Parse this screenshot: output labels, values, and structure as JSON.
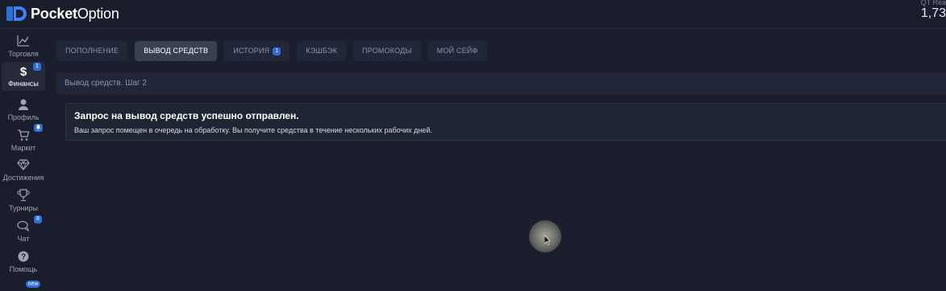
{
  "app": {
    "logo_bold": "Pocket",
    "logo_light": "Option",
    "balance_label": "QT Rea",
    "balance_value": "1,73"
  },
  "sidebar": {
    "items": [
      {
        "label": "Торговля",
        "icon": "chart-icon"
      },
      {
        "label": "Финансы",
        "icon": "dollar-icon",
        "badge": "1",
        "active": true
      },
      {
        "label": "Профиль",
        "icon": "user-icon"
      },
      {
        "label": "Маркет",
        "icon": "cart-icon",
        "badge_icon": "bell-icon"
      },
      {
        "label": "Достижения",
        "icon": "diamond-icon"
      },
      {
        "label": "Турниры",
        "icon": "trophy-icon"
      },
      {
        "label": "Чат",
        "icon": "chat-icon",
        "badge": "8"
      },
      {
        "label": "Помощь",
        "icon": "help-icon"
      }
    ],
    "new_badge": "new"
  },
  "tabs": [
    {
      "label": "ПОПОЛНЕНИЕ"
    },
    {
      "label": "ВЫВОД СРЕДСТВ",
      "active": true
    },
    {
      "label": "ИСТОРИЯ",
      "badge": "1"
    },
    {
      "label": "КЭШБЭК"
    },
    {
      "label": "ПРОМОКОДЫ"
    },
    {
      "label": "МОЙ СЕЙФ"
    }
  ],
  "step": {
    "label": "Вывод средств. Шаг 2"
  },
  "notice": {
    "title": "Запрос на вывод средств успешно отправлен.",
    "message": "Ваш запрос помещен в очередь на обработку. Вы получите средства в течение нескольких рабочих дней."
  },
  "colors": {
    "background": "#1b1e2d",
    "accent": "#2e6fd6",
    "tab_active": "#3a3f52"
  }
}
